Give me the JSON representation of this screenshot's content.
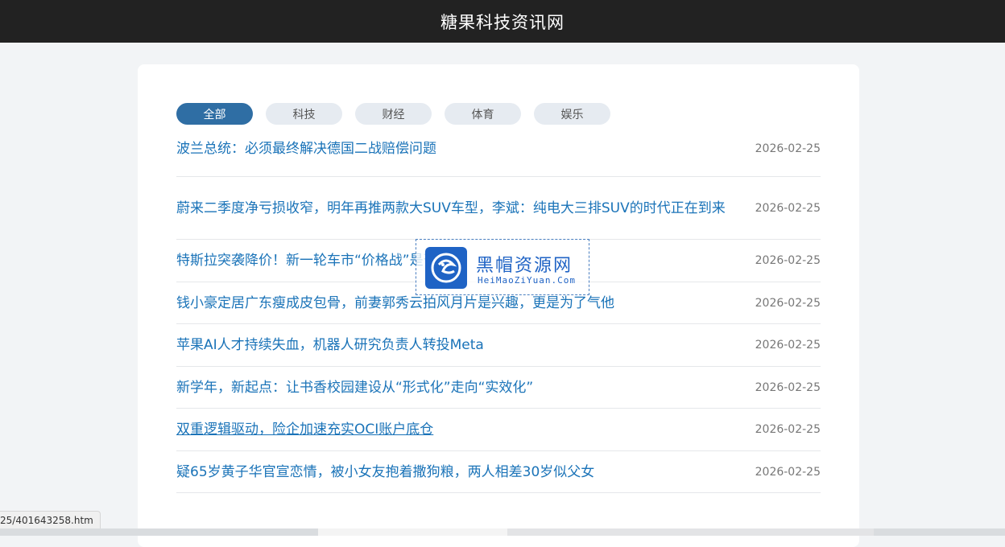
{
  "site": {
    "title": "糖果科技资讯网"
  },
  "tabs": [
    {
      "label": "全部",
      "active": true
    },
    {
      "label": "科技",
      "active": false
    },
    {
      "label": "财经",
      "active": false
    },
    {
      "label": "体育",
      "active": false
    },
    {
      "label": "娱乐",
      "active": false
    }
  ],
  "news": [
    {
      "title": "波兰总统：必须最终解决德国二战赔偿问题",
      "date": "2026-02-25"
    },
    {
      "title": "蔚来二季度净亏损收窄，明年再推两款大SUV车型，李斌：纯电大三排SUV的时代正在到来",
      "date": "2026-02-25"
    },
    {
      "title": "特斯拉突袭降价！新一轮车市“价格战”是否已然",
      "date": "2026-02-25"
    },
    {
      "title": "钱小豪定居广东瘦成皮包骨，前妻郭秀云拍风月片是兴趣，更是为了气他",
      "date": "2026-02-25"
    },
    {
      "title": "苹果AI人才持续失血，机器人研究负责人转投Meta",
      "date": "2026-02-25"
    },
    {
      "title": "新学年，新起点：让书香校园建设从“形式化”走向“实效化”",
      "date": "2026-02-25"
    },
    {
      "title": "双重逻辑驱动，险企加速充实OCI账户底仓",
      "date": "2026-02-25",
      "hovered": true
    },
    {
      "title": "疑65岁黄子华官宣恋情，被小女友抱着撒狗粮，两人相差30岁似父女",
      "date": "2026-02-25"
    }
  ],
  "watermark": {
    "title": "黑帽资源网",
    "subtitle": "HeiMaoZiYuan.Com"
  },
  "status": {
    "url": "25/401643258.htm"
  },
  "colors": {
    "header": "#222222",
    "accent": "#2f6ea4",
    "link": "#1a73b8"
  }
}
